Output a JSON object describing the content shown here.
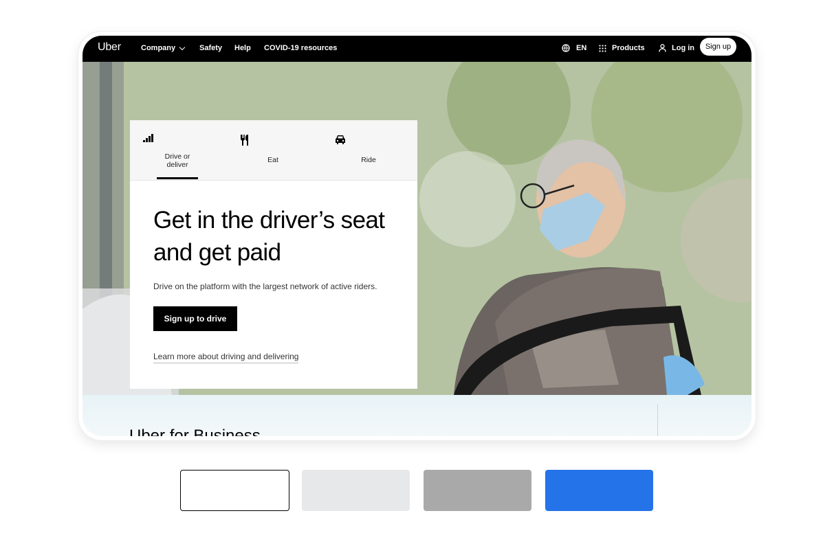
{
  "nav": {
    "logo": "Uber",
    "items": [
      "Company",
      "Safety",
      "Help",
      "COVID-19 resources"
    ],
    "language": "EN",
    "products": "Products",
    "login": "Log in",
    "signup": "Sign up"
  },
  "hero": {
    "tabs": [
      {
        "label": "Drive or deliver",
        "icon": "signal-bars-icon",
        "active": true
      },
      {
        "label": "Eat",
        "icon": "fork-knife-icon",
        "active": false
      },
      {
        "label": "Ride",
        "icon": "car-icon",
        "active": false
      }
    ],
    "headline": "Get in the driver’s seat and get paid",
    "subtext": "Drive on the platform with the largest network of active riders.",
    "cta": "Sign up to drive",
    "learn_more": "Learn more about driving and delivering"
  },
  "section": {
    "title": "Uber for Business"
  },
  "swatches": [
    {
      "name": "white-outline",
      "color": "#ffffff"
    },
    {
      "name": "light-gray",
      "color": "#e7e8e9"
    },
    {
      "name": "medium-gray",
      "color": "#a9a9a9"
    },
    {
      "name": "blue",
      "color": "#2473e8"
    }
  ]
}
